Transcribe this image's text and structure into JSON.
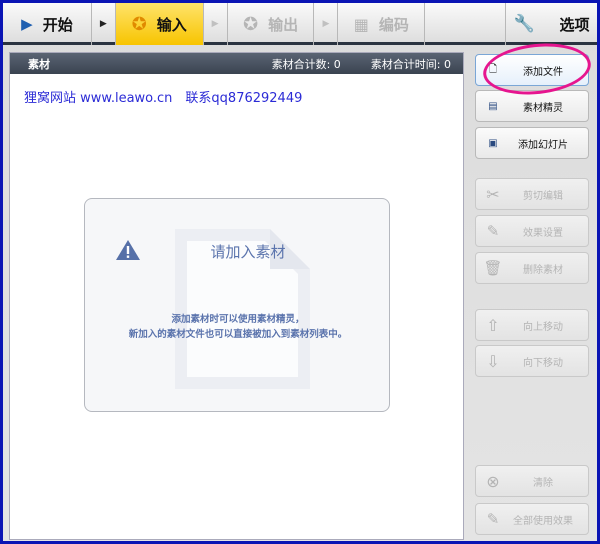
{
  "toolbar": {
    "start": "开始",
    "input": "输入",
    "output": "输出",
    "encode": "编码",
    "options": "选项"
  },
  "panel": {
    "title": "素材",
    "count_label": "素材合计数: 0",
    "time_label": "素材合计时间: 0"
  },
  "link_text": "狸窝网站 www.leawo.cn　联系qq876292449",
  "empty": {
    "title": "请加入素材",
    "line1": "添加素材时可以使用素材精灵，",
    "line2": "新加入的素材文件也可以直接被加入到素材列表中。"
  },
  "buttons": {
    "add_file": "添加文件",
    "wizard": "素材精灵",
    "add_slideshow": "添加幻灯片",
    "cut": "剪切编辑",
    "effects": "效果设置",
    "delete": "删除素材",
    "move_up": "向上移动",
    "move_down": "向下移动",
    "clear": "清除",
    "apply_all": "全部使用效果"
  },
  "colors": {
    "accent": "#f7c400",
    "highlight": "#e6158f",
    "border": "#0a14b4"
  }
}
